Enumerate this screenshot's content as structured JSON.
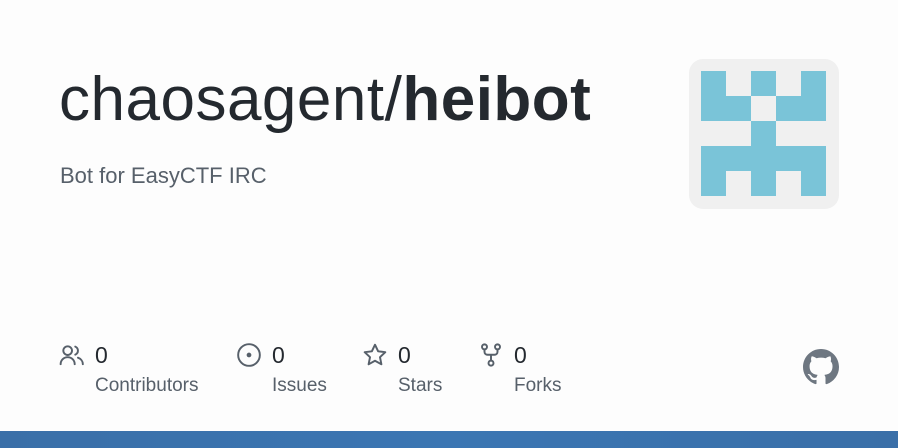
{
  "repo": {
    "owner": "chaosagent",
    "separator": "/",
    "name": "heibot",
    "description": "Bot for EasyCTF IRC"
  },
  "stats": [
    {
      "icon": "people-icon",
      "count": "0",
      "label": "Contributors"
    },
    {
      "icon": "issue-opened-icon",
      "count": "0",
      "label": "Issues"
    },
    {
      "icon": "star-icon",
      "count": "0",
      "label": "Stars"
    },
    {
      "icon": "repo-forked-icon",
      "count": "0",
      "label": "Forks"
    }
  ],
  "colors": {
    "avatar_identicon": "#7ac4d8",
    "avatar_background": "#f0f0f0",
    "bottom_bar": "#3b76b3",
    "icon_gray": "#57606a"
  },
  "brand_icon": "github-mark-icon"
}
